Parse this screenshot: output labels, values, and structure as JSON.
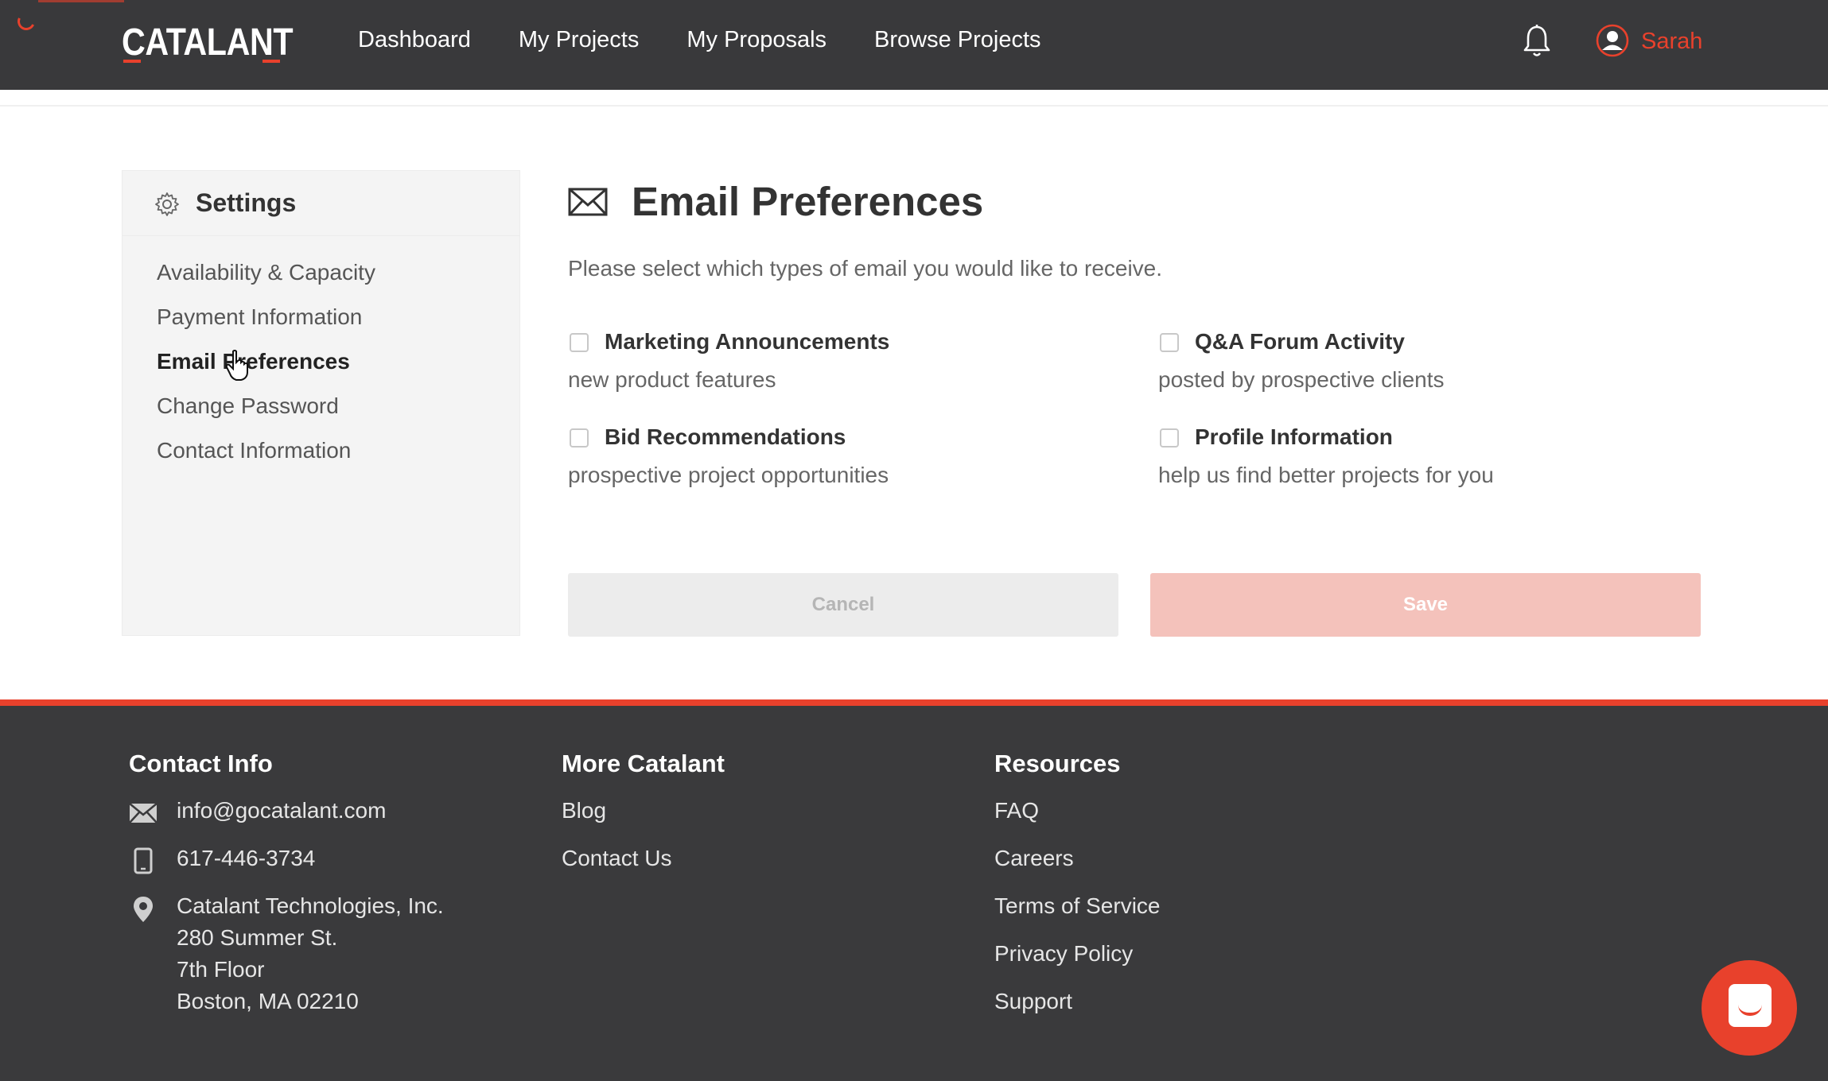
{
  "header": {
    "logo": "CATALANT",
    "nav": [
      "Dashboard",
      "My Projects",
      "My Proposals",
      "Browse Projects"
    ],
    "user_name": "Sarah"
  },
  "sidebar": {
    "title": "Settings",
    "items": [
      {
        "label": "Availability & Capacity"
      },
      {
        "label": "Payment Information"
      },
      {
        "label": "Email Preferences"
      },
      {
        "label": "Change Password"
      },
      {
        "label": "Contact Information"
      }
    ],
    "active_index": 2
  },
  "main": {
    "title": "Email Preferences",
    "subtitle": "Please select which types of email you would like to receive.",
    "options": [
      {
        "label": "Marketing Announcements",
        "desc": "new product features",
        "checked": false
      },
      {
        "label": "Q&A Forum Activity",
        "desc": "posted by prospective clients",
        "checked": false
      },
      {
        "label": "Bid Recommendations",
        "desc": "prospective project opportunities",
        "checked": false
      },
      {
        "label": "Profile Information",
        "desc": "help us find better projects for you",
        "checked": false
      }
    ],
    "cancel_label": "Cancel",
    "save_label": "Save"
  },
  "footer": {
    "contact": {
      "title": "Contact Info",
      "email": "info@gocatalant.com",
      "phone": "617-446-3734",
      "address": [
        "Catalant Technologies, Inc.",
        "280 Summer St.",
        "7th Floor",
        "Boston, MA 02210"
      ]
    },
    "more": {
      "title": "More Catalant",
      "links": [
        "Blog",
        "Contact Us"
      ]
    },
    "resources": {
      "title": "Resources",
      "links": [
        "FAQ",
        "Careers",
        "Terms of Service",
        "Privacy Policy",
        "Support"
      ]
    }
  },
  "colors": {
    "accent": "#e8412c",
    "header_bg": "#39393b",
    "footer_bg": "#3a3a3c",
    "sidebar_bg": "#f4f4f4",
    "save_disabled": "#f4c2bb"
  },
  "icons": [
    "spinner-icon",
    "bell-icon",
    "user-avatar-icon",
    "gear-icon",
    "envelope-icon",
    "mail-icon",
    "phone-icon",
    "location-pin-icon",
    "chat-icon",
    "pointer-cursor-icon"
  ]
}
